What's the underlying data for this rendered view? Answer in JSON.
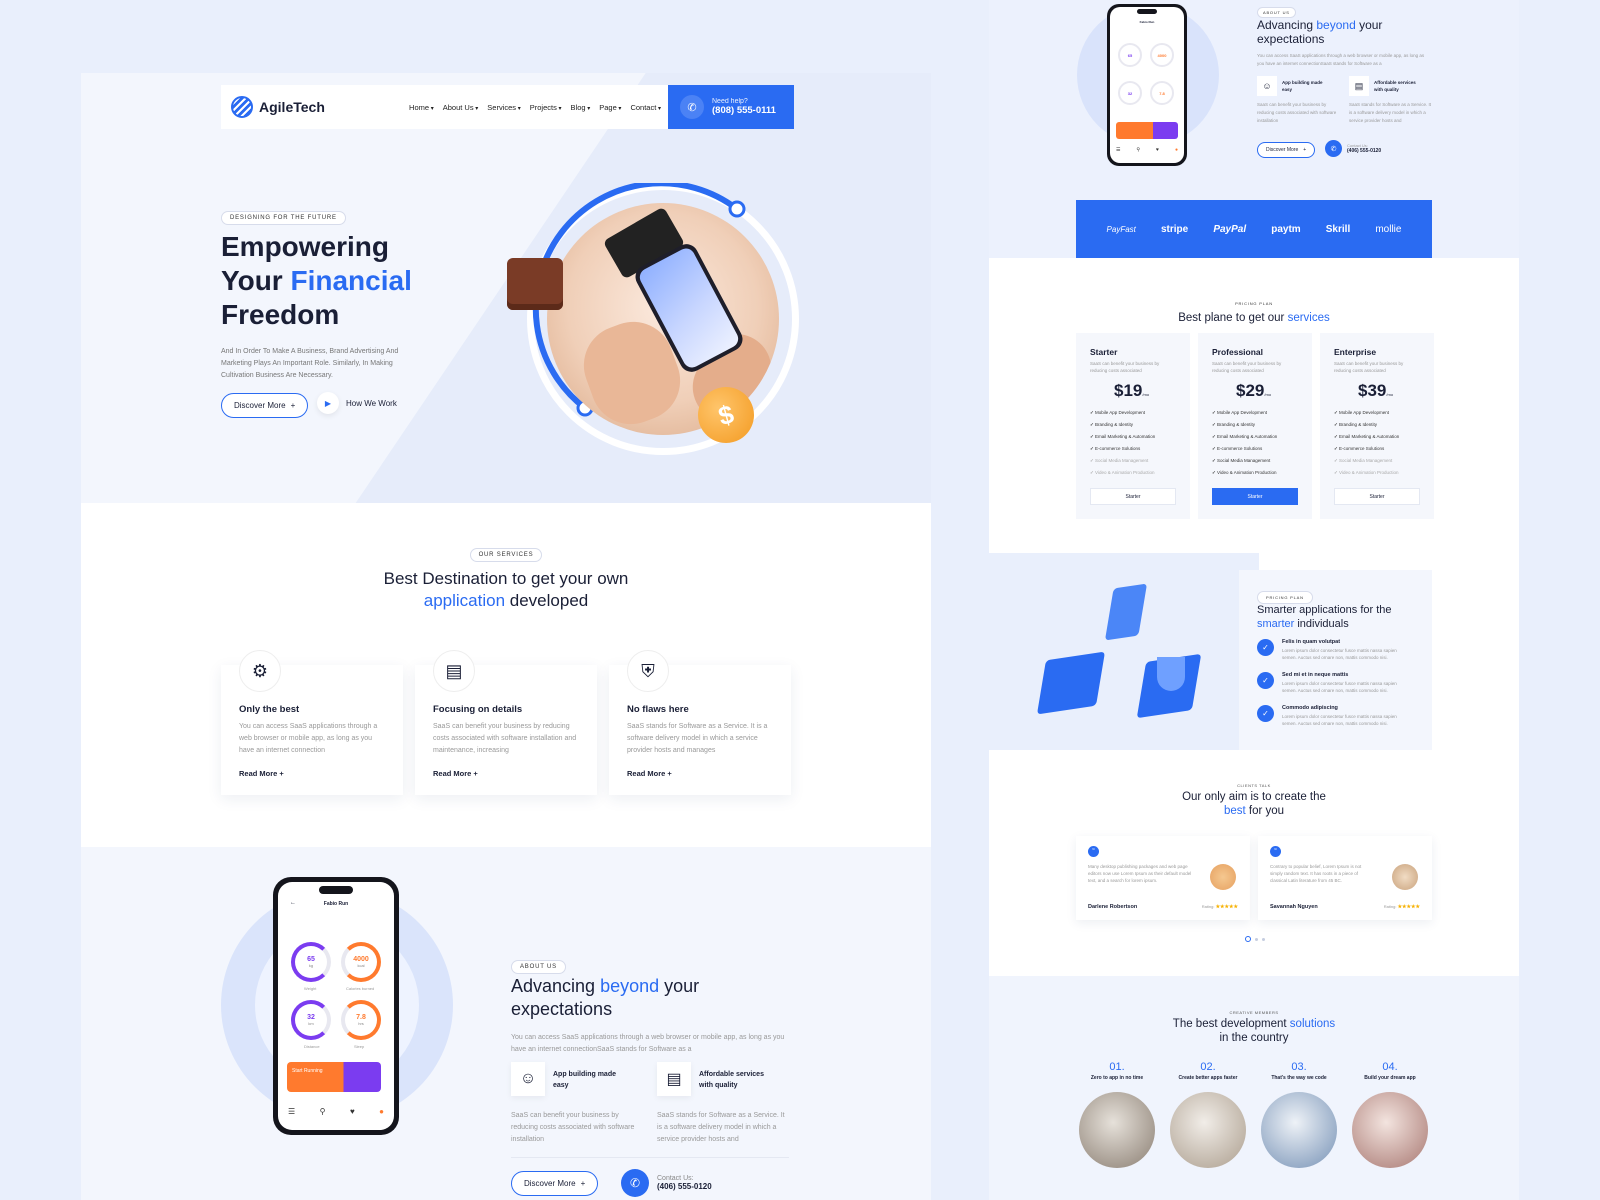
{
  "brand": {
    "name": "AgileTech"
  },
  "nav": {
    "items": [
      "Home",
      "About Us",
      "Services",
      "Projects",
      "Blog",
      "Page",
      "Contact"
    ],
    "help_label": "Need help?",
    "help_phone": "(808) 555-0111"
  },
  "hero": {
    "eyebrow": "DESIGNING FOR THE FUTURE",
    "title_1": "Empowering",
    "title_2": "Your ",
    "title_highlight": "Financial",
    "title_3": "Freedom",
    "description": "And In Order To Make A Business, Brand Advertising And Marketing Plays An Important Role. Similarly, In Making Cultivation Business Are Necessary.",
    "primary_button": "Discover More",
    "secondary_button": "How We Work",
    "coin_symbol": "$"
  },
  "services": {
    "eyebrow": "OUR SERVICES",
    "title_1": "Best Destination to get your own",
    "title_highlight": "application",
    "title_2": " developed",
    "cards": [
      {
        "title": "Only the best",
        "text": "You can access SaaS applications through a web browser or mobile app, as long as you have an internet connection",
        "link": "Read More",
        "icon": "settings-gear-icon"
      },
      {
        "title": "Focusing on details",
        "text": "SaaS can benefit your business by reducing costs associated with software installation and maintenance, increasing",
        "link": "Read More",
        "icon": "server-check-icon"
      },
      {
        "title": "No flaws here",
        "text": "SaaS stands for Software as a Service. It is a software delivery model in which a service provider hosts and manages",
        "link": "Read More",
        "icon": "shield-check-icon"
      }
    ]
  },
  "about": {
    "eyebrow": "ABOUT US",
    "title_1": "Advancing ",
    "title_highlight": "beyond",
    "title_2": " your expectations",
    "description": "You can access SaaS applications through a web browser or mobile app, as long as you have an internet connectionSaaS stands for Software as a",
    "features": [
      {
        "title": "App building made easy",
        "text": "SaaS can benefit your business by reducing costs associated with software installation",
        "icon": "developer-avatar-icon"
      },
      {
        "title": "Affordable services with quality",
        "text": "SaaS stands for Software as a Service. It is a software delivery model in which a service provider hosts and",
        "icon": "document-chart-icon"
      }
    ],
    "button": "Discover More",
    "contact_label": "Contact Us:",
    "contact_phone": "(406) 555-0120",
    "phone_app": {
      "header": "Fabio Run",
      "gauges": [
        {
          "value": "65",
          "unit": "kg",
          "label": "Weight"
        },
        {
          "value": "4000",
          "unit": "kcal",
          "label": "Calories burned"
        },
        {
          "value": "32",
          "unit": "km",
          "label": "Distance"
        },
        {
          "value": "7.8",
          "unit": "hrs",
          "label": "Sleep"
        }
      ],
      "promo": "Start Running"
    }
  },
  "partners": [
    "PayFast",
    "stripe",
    "PayPal",
    "paytm",
    "Skrill",
    "mollie"
  ],
  "pricing": {
    "eyebrow": "PRICING PLAN",
    "title_1": "Best plane to get our ",
    "title_highlight": "services",
    "plans": [
      {
        "name": "Starter",
        "desc": "SaaS can benefit your business by reducing costs associated",
        "price": "$19",
        "per": "/mo",
        "button": "Starter",
        "active": false,
        "features": [
          "Mobile App Development",
          "Branding & Identity",
          "Email Marketing & Automation",
          "E-commerce Solutions",
          "Social Media Management",
          "Video & Animation Production"
        ],
        "enabled": 4
      },
      {
        "name": "Professional",
        "desc": "SaaS can benefit your business by reducing costs associated",
        "price": "$29",
        "per": "/mo",
        "button": "Starter",
        "active": true,
        "features": [
          "Mobile App Development",
          "Branding & Identity",
          "Email Marketing & Automation",
          "E-commerce Solutions",
          "Social Media Management",
          "Video & Animation Production"
        ],
        "enabled": 6
      },
      {
        "name": "Enterprise",
        "desc": "SaaS can benefit your business by reducing costs associated",
        "price": "$39",
        "per": "/mo",
        "button": "Starter",
        "active": false,
        "features": [
          "Mobile App Development",
          "Branding & Identity",
          "Email Marketing & Automation",
          "E-commerce Solutions",
          "Social Media Management",
          "Video & Animation Production"
        ],
        "enabled": 4
      }
    ]
  },
  "smarter": {
    "eyebrow": "PRICING PLAN",
    "title_1": "Smarter applications for the ",
    "title_highlight": "smarter",
    "title_2": " individuals",
    "items": [
      {
        "title": "Felis in quam volutpat",
        "text": "Lorem ipsum dolor consectetur fusce mattis nassa sapien semen. Auctus sed ornare non, mattis commodo nisi."
      },
      {
        "title": "Sed mi et in neque mattis",
        "text": "Lorem ipsum dolor consectetur fusce mattis nassa sapien semen. Auctus sed ornare non, mattis commodo nisi."
      },
      {
        "title": "Commodo adipiscing",
        "text": "Lorem ipsum dolor consectetur fusce mattis nassa sapien semen. Auctus sed ornare non, mattis commodo nisi."
      }
    ]
  },
  "testimonials": {
    "eyebrow": "CLIENTS TALK",
    "title_1": "Our only aim is to create the",
    "title_highlight": "best",
    "title_2": " for you",
    "rating_label": "Rating:",
    "stars": "★★★★★",
    "items": [
      {
        "text": "Many desktop publishing packages and web page editors now use Lorem Ipsum as their default model text, and a search for lorem ipsum.",
        "name": "Darlene Robertson"
      },
      {
        "text": "Contrary to popular belief, Lorem Ipsum is not simply random text. It has roots in a piece of classical Latin literature from 45 BC.",
        "name": "Savannah Nguyen"
      }
    ]
  },
  "team": {
    "eyebrow": "CREATIVE MEMBERS",
    "title_1": "The best development ",
    "title_highlight": "solutions",
    "title_2": "in the country",
    "steps": [
      {
        "num": "01.",
        "label": "Zero to app in no time"
      },
      {
        "num": "02.",
        "label": "Create better apps faster"
      },
      {
        "num": "03.",
        "label": "That's the way we code"
      },
      {
        "num": "04.",
        "label": "Build your dream app"
      }
    ]
  },
  "colors": {
    "accent": "#2a6bf2",
    "page_bg": "#e9effc",
    "orange": "#ff7a2e",
    "purple": "#7b3cf0",
    "star": "#f6b100"
  }
}
